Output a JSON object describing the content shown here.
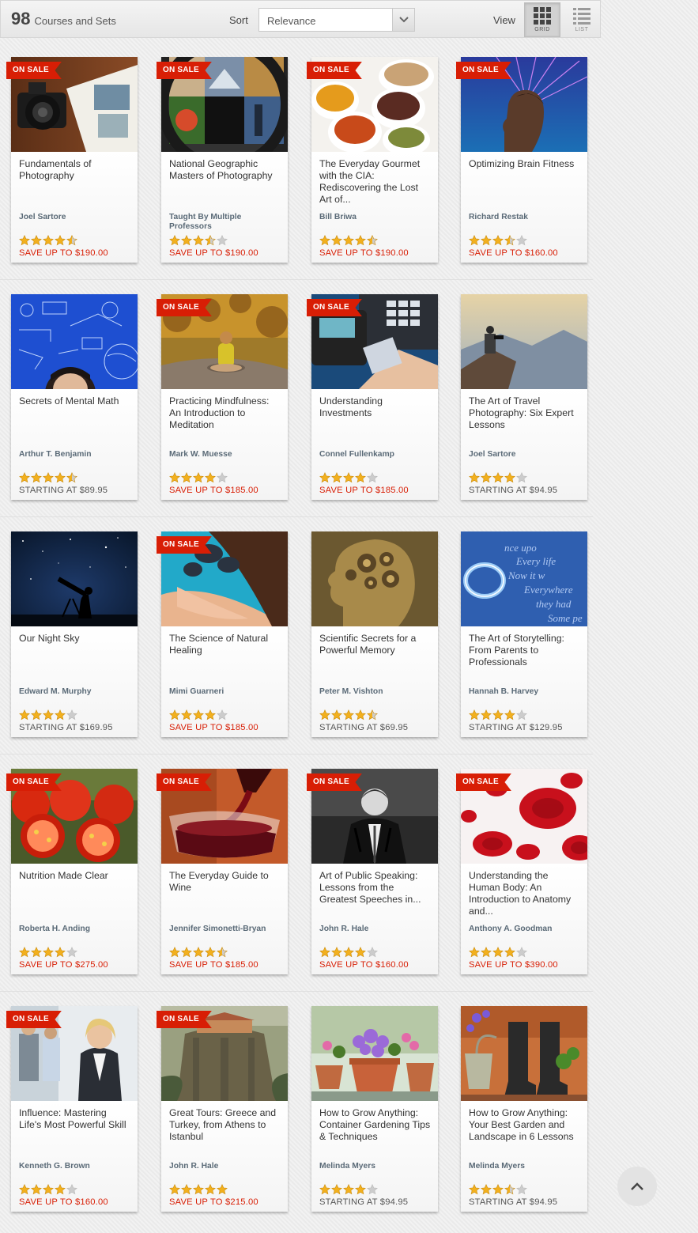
{
  "toolbar": {
    "count": "98",
    "count_label": "Courses and Sets",
    "sort_label": "Sort",
    "sort_value": "Relevance",
    "view_label": "View",
    "view_grid": "GRID",
    "view_list": "LIST"
  },
  "colors": {
    "sale_badge": "#d81e05",
    "star": "#f2b01e",
    "star_empty": "#cccccc",
    "sale_price": "#d81e05"
  },
  "courses": [
    {
      "title": "Fundamentals of Photography",
      "professor": "Joel Sartore",
      "rating": 4.5,
      "price": "SAVE UP TO $190.00",
      "on_sale": true,
      "sale_label": "ON SALE",
      "thumb": "camera-book"
    },
    {
      "title": "National Geographic Masters of Photography",
      "professor": "Taught By Multiple Professors",
      "rating": 3.5,
      "price": "SAVE UP TO $190.00",
      "on_sale": true,
      "sale_label": "ON SALE",
      "thumb": "photo-collage"
    },
    {
      "title": "The Everyday Gourmet with the CIA: Rediscovering the Lost Art of...",
      "professor": "Bill Briwa",
      "rating": 4.5,
      "price": "SAVE UP TO $190.00",
      "on_sale": true,
      "sale_label": "ON SALE",
      "thumb": "spices"
    },
    {
      "title": "Optimizing Brain Fitness",
      "professor": "Richard Restak",
      "rating": 3.5,
      "price": "SAVE UP TO $160.00",
      "on_sale": true,
      "sale_label": "ON SALE",
      "thumb": "brain-light"
    },
    {
      "title": "Secrets of Mental Math",
      "professor": "Arthur T. Benjamin",
      "rating": 4.5,
      "price": "STARTING AT $89.95",
      "on_sale": false,
      "thumb": "math-board"
    },
    {
      "title": "Practicing Mindfulness: An Introduction to Meditation",
      "professor": "Mark W. Muesse",
      "rating": 4,
      "price": "SAVE UP TO $185.00",
      "on_sale": true,
      "sale_label": "ON SALE",
      "thumb": "meditation"
    },
    {
      "title": "Understanding Investments",
      "professor": "Connel Fullenkamp",
      "rating": 4,
      "price": "SAVE UP TO $185.00",
      "on_sale": true,
      "sale_label": "ON SALE",
      "thumb": "card-terminal"
    },
    {
      "title": "The Art of Travel Photography: Six Expert Lessons",
      "professor": "Joel Sartore",
      "rating": 4,
      "price": "STARTING AT $94.95",
      "on_sale": false,
      "thumb": "mountain-photographer"
    },
    {
      "title": "Our Night Sky",
      "professor": "Edward M. Murphy",
      "rating": 4,
      "price": "STARTING AT $169.95",
      "on_sale": false,
      "thumb": "telescope"
    },
    {
      "title": "The Science of Natural Healing",
      "professor": "Mimi Guarneri",
      "rating": 4,
      "price": "SAVE UP TO $185.00",
      "on_sale": true,
      "sale_label": "ON SALE",
      "thumb": "hot-stones"
    },
    {
      "title": "Scientific Secrets for a Powerful Memory",
      "professor": "Peter M. Vishton",
      "rating": 4.5,
      "price": "STARTING AT $69.95",
      "on_sale": false,
      "thumb": "gear-head"
    },
    {
      "title": "The Art of Storytelling: From Parents to Professionals",
      "professor": "Hannah B. Harvey",
      "rating": 4,
      "price": "STARTING AT $129.95",
      "on_sale": false,
      "thumb": "ring-text"
    },
    {
      "title": "Nutrition Made Clear",
      "professor": "Roberta H. Anding",
      "rating": 4,
      "price": "SAVE UP TO $275.00",
      "on_sale": true,
      "sale_label": "ON SALE",
      "thumb": "tomatoes"
    },
    {
      "title": "The Everyday Guide to Wine",
      "professor": "Jennifer Simonetti-Bryan",
      "rating": 4.5,
      "price": "SAVE UP TO $185.00",
      "on_sale": true,
      "sale_label": "ON SALE",
      "thumb": "wine"
    },
    {
      "title": "Art of Public Speaking: Lessons from the Greatest Speeches in...",
      "professor": "John R. Hale",
      "rating": 4,
      "price": "SAVE UP TO $160.00",
      "on_sale": true,
      "sale_label": "ON SALE",
      "thumb": "speaker"
    },
    {
      "title": "Understanding the Human Body: An Introduction to Anatomy and...",
      "professor": "Anthony A. Goodman",
      "rating": 4,
      "price": "SAVE UP TO $390.00",
      "on_sale": true,
      "sale_label": "ON SALE",
      "thumb": "blood-cells"
    },
    {
      "title": "Influence: Mastering Life's Most Powerful Skill",
      "professor": "Kenneth G. Brown",
      "rating": 4,
      "price": "SAVE UP TO $160.00",
      "on_sale": true,
      "sale_label": "ON SALE",
      "thumb": "business"
    },
    {
      "title": "Great Tours: Greece and Turkey, from Athens to Istanbul",
      "professor": "John R. Hale",
      "rating": 5,
      "price": "SAVE UP TO $215.00",
      "on_sale": true,
      "sale_label": "ON SALE",
      "thumb": "monastery"
    },
    {
      "title": "How to Grow Anything: Container Gardening Tips & Techniques",
      "professor": "Melinda Myers",
      "rating": 4,
      "price": "STARTING AT $94.95",
      "on_sale": false,
      "thumb": "flower-pots"
    },
    {
      "title": "How to Grow Anything: Your Best Garden and Landscape in 6 Lessons",
      "professor": "Melinda Myers",
      "rating": 3.5,
      "price": "STARTING AT $94.95",
      "on_sale": false,
      "thumb": "boots"
    }
  ]
}
